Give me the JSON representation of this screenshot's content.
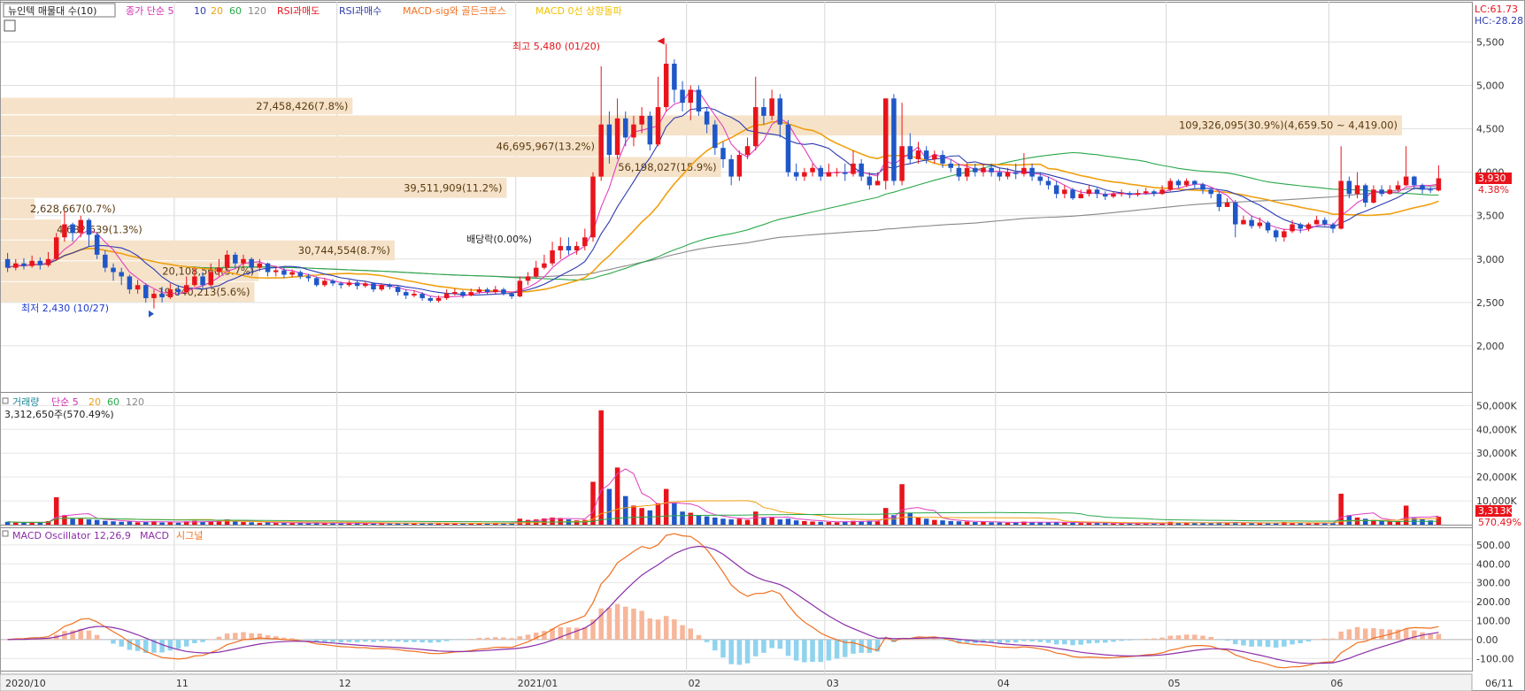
{
  "legend": {
    "stock_name": "뉴인텍 매물대 수(10)",
    "ma_label": "종가 단순 5",
    "ma_10": "10",
    "ma_20": "20",
    "ma_60": "60",
    "ma_120": "120",
    "rsi_sell": "RSI과매도",
    "rsi_buy": "RSI과매수",
    "macd_gc": "MACD-sig와 골든크로스",
    "macd_zero": "MACD 0선 상향돌파"
  },
  "corner": {
    "lc": "LC:61.73",
    "hc": "HC:-28.28"
  },
  "price_tags": {
    "current": "3,930",
    "pct": "4.38%"
  },
  "annotations": {
    "high": "최고 5,480 (01/20)",
    "low": "최저 2,430 (10/27)",
    "dividend": "배당락(0.00%)"
  },
  "volume_legend": {
    "title": "거래량",
    "ma": "단순 5",
    "p20": "20",
    "p60": "60",
    "p120": "120",
    "info": "3,312,650주(570.49%)"
  },
  "volume_tags": {
    "current": "3,313K",
    "pct": "570.49%"
  },
  "macd_legend": {
    "title": "MACD Oscillator 12,26,9",
    "macd": "MACD",
    "signal": "시그널"
  },
  "colors": {
    "up": "#e8141c",
    "down": "#1f57c8",
    "ma5": "#e040c0",
    "ma10": "#2d3bb0",
    "ma20": "#f0a010",
    "ma60": "#2aa84a",
    "ma120": "#888888",
    "vp": "#f5e2c8",
    "macd_pos": "#f7b69a",
    "macd_neg": "#8fd3ee",
    "macd": "#8b2ea8",
    "signal": "#f07020"
  },
  "chart_data": {
    "type": "candlestick",
    "date_ticks": [
      "2020/10",
      "11",
      "12",
      "2021/01",
      "02",
      "03",
      "04",
      "05",
      "06",
      "06/11"
    ],
    "price_axis": {
      "ticks": [
        "5,500",
        "5,000",
        "4,500",
        "4,000",
        "3,500",
        "3,000",
        "2,500",
        "2,000"
      ],
      "range": [
        1500,
        5780
      ]
    },
    "volume_axis": {
      "ticks": [
        "50,000K",
        "40,000K",
        "30,000K",
        "20,000K",
        "10,000K"
      ],
      "range": [
        0,
        52000
      ]
    },
    "macd_axis": {
      "ticks": [
        "500.00",
        "400.00",
        "300.00",
        "200.00",
        "100.00",
        "0.00",
        "-100.00"
      ],
      "range": [
        -150,
        560
      ]
    },
    "volume_profile": [
      {
        "label": "27,458,426(7.8%)",
        "price_lo": 4663,
        "price_hi": 4863,
        "width_frac": 0.251
      },
      {
        "label": "109,326,095(30.9%)(4,659.50 ~ 4,419.00)",
        "price_lo": 4419,
        "price_hi": 4660,
        "width_frac": 1.0
      },
      {
        "label": "46,695,967(13.2%)",
        "price_lo": 4180,
        "price_hi": 4419,
        "width_frac": 0.427
      },
      {
        "label": "56,198,027(15.9%)",
        "price_lo": 3940,
        "price_hi": 4180,
        "width_frac": 0.514
      },
      {
        "label": "39,511,909(11.2%)",
        "price_lo": 3700,
        "price_hi": 3940,
        "width_frac": 0.361
      },
      {
        "label": "2,628,667(0.7%)",
        "price_lo": 3460,
        "price_hi": 3700,
        "width_frac": 0.024
      },
      {
        "label": "4,682,639(1.3%)",
        "price_lo": 3220,
        "price_hi": 3460,
        "width_frac": 0.043
      },
      {
        "label": "30,744,554(8.7%)",
        "price_lo": 2980,
        "price_hi": 3220,
        "width_frac": 0.281
      },
      {
        "label": "20,108,560(5.7%)",
        "price_lo": 2740,
        "price_hi": 2980,
        "width_frac": 0.184
      },
      {
        "label": "19,840,213(5.6%)",
        "price_lo": 2500,
        "price_hi": 2740,
        "width_frac": 0.181
      }
    ],
    "candles": [
      [
        3000,
        2900,
        3070,
        2850,
        1200
      ],
      [
        2900,
        2950,
        3000,
        2870,
        900
      ],
      [
        2950,
        2920,
        3010,
        2880,
        800
      ],
      [
        2920,
        2980,
        3040,
        2900,
        1000
      ],
      [
        2980,
        2930,
        3020,
        2880,
        900
      ],
      [
        2930,
        3000,
        3080,
        2910,
        1500
      ],
      [
        3000,
        3250,
        3300,
        2980,
        11500
      ],
      [
        3250,
        3400,
        3550,
        3200,
        4000
      ],
      [
        3400,
        3300,
        3420,
        3200,
        2500
      ],
      [
        3300,
        3450,
        3500,
        3250,
        2800
      ],
      [
        3450,
        3280,
        3470,
        3150,
        2200
      ],
      [
        3280,
        3050,
        3300,
        3000,
        2000
      ],
      [
        3050,
        2900,
        3100,
        2850,
        1600
      ],
      [
        2900,
        2850,
        2950,
        2750,
        1400
      ],
      [
        2850,
        2800,
        2900,
        2700,
        1200
      ],
      [
        2800,
        2650,
        2820,
        2600,
        1300
      ],
      [
        2650,
        2700,
        2760,
        2600,
        1000
      ],
      [
        2700,
        2550,
        2720,
        2500,
        1200
      ],
      [
        2550,
        2600,
        2650,
        2430,
        1500
      ],
      [
        2600,
        2560,
        2680,
        2500,
        900
      ],
      [
        2560,
        2650,
        2720,
        2540,
        1100
      ],
      [
        2650,
        2620,
        2700,
        2580,
        800
      ],
      [
        2620,
        2700,
        2800,
        2600,
        1400
      ],
      [
        2700,
        2800,
        2900,
        2680,
        1600
      ],
      [
        2800,
        2700,
        2850,
        2650,
        1200
      ],
      [
        2700,
        2850,
        2950,
        2680,
        1500
      ],
      [
        2850,
        2900,
        3000,
        2800,
        1400
      ],
      [
        2900,
        3050,
        3100,
        2880,
        2200
      ],
      [
        3050,
        2950,
        3080,
        2900,
        1500
      ],
      [
        2950,
        3000,
        3050,
        2900,
        1100
      ],
      [
        3000,
        2900,
        3020,
        2850,
        1000
      ],
      [
        2900,
        2950,
        3000,
        2860,
        800
      ],
      [
        2950,
        2850,
        2960,
        2800,
        900
      ],
      [
        2850,
        2870,
        2920,
        2800,
        700
      ],
      [
        2870,
        2820,
        2900,
        2780,
        800
      ],
      [
        2820,
        2850,
        2880,
        2790,
        600
      ],
      [
        2850,
        2800,
        2870,
        2770,
        700
      ],
      [
        2800,
        2780,
        2830,
        2740,
        600
      ],
      [
        2780,
        2700,
        2800,
        2680,
        800
      ],
      [
        2700,
        2750,
        2780,
        2680,
        700
      ],
      [
        2750,
        2720,
        2770,
        2690,
        600
      ],
      [
        2720,
        2700,
        2740,
        2660,
        500
      ],
      [
        2700,
        2730,
        2760,
        2680,
        500
      ],
      [
        2730,
        2690,
        2750,
        2650,
        600
      ],
      [
        2690,
        2720,
        2740,
        2670,
        500
      ],
      [
        2720,
        2650,
        2730,
        2620,
        700
      ],
      [
        2650,
        2700,
        2720,
        2630,
        600
      ],
      [
        2700,
        2680,
        2720,
        2650,
        500
      ],
      [
        2680,
        2620,
        2700,
        2580,
        700
      ],
      [
        2620,
        2580,
        2650,
        2540,
        800
      ],
      [
        2580,
        2600,
        2640,
        2560,
        600
      ],
      [
        2600,
        2550,
        2620,
        2520,
        700
      ],
      [
        2550,
        2520,
        2570,
        2500,
        600
      ],
      [
        2520,
        2550,
        2580,
        2500,
        500
      ],
      [
        2550,
        2600,
        2650,
        2530,
        600
      ],
      [
        2600,
        2620,
        2660,
        2580,
        500
      ],
      [
        2620,
        2580,
        2640,
        2550,
        600
      ],
      [
        2580,
        2620,
        2660,
        2570,
        500
      ],
      [
        2620,
        2650,
        2680,
        2600,
        600
      ],
      [
        2650,
        2620,
        2670,
        2590,
        500
      ],
      [
        2620,
        2650,
        2690,
        2600,
        700
      ],
      [
        2650,
        2600,
        2670,
        2580,
        600
      ],
      [
        2600,
        2570,
        2620,
        2540,
        800
      ],
      [
        2570,
        2750,
        2800,
        2560,
        2500
      ],
      [
        2750,
        2800,
        2850,
        2700,
        2000
      ],
      [
        2800,
        2900,
        2980,
        2780,
        2200
      ],
      [
        2900,
        2950,
        3050,
        2880,
        2600
      ],
      [
        2950,
        3100,
        3200,
        2920,
        3000
      ],
      [
        3100,
        3150,
        3250,
        3000,
        2800
      ],
      [
        3150,
        3100,
        3250,
        3050,
        2200
      ],
      [
        3100,
        3150,
        3200,
        3050,
        1800
      ],
      [
        3150,
        3250,
        3350,
        3100,
        2000
      ],
      [
        3250,
        3950,
        4000,
        3200,
        18000
      ],
      [
        3950,
        4550,
        5220,
        3900,
        48000
      ],
      [
        4550,
        4200,
        4700,
        4100,
        15000
      ],
      [
        4200,
        4620,
        4850,
        4150,
        24000
      ],
      [
        4620,
        4400,
        4700,
        4300,
        12000
      ],
      [
        4400,
        4550,
        4650,
        4300,
        8000
      ],
      [
        4550,
        4650,
        4750,
        4450,
        7000
      ],
      [
        4650,
        4320,
        4700,
        4250,
        6000
      ],
      [
        4320,
        4750,
        5100,
        4300,
        9000
      ],
      [
        4750,
        5250,
        5480,
        4700,
        15000
      ],
      [
        5250,
        4950,
        5300,
        4800,
        9000
      ],
      [
        4950,
        4800,
        5050,
        4700,
        5500
      ],
      [
        4800,
        4950,
        5000,
        4600,
        5000
      ],
      [
        4950,
        4700,
        5000,
        4650,
        4000
      ],
      [
        4700,
        4550,
        4750,
        4450,
        3500
      ],
      [
        4550,
        4280,
        4600,
        4200,
        3000
      ],
      [
        4280,
        4150,
        4350,
        4050,
        2500
      ],
      [
        4150,
        3950,
        4200,
        3850,
        2200
      ],
      [
        3950,
        4200,
        4250,
        3900,
        2500
      ],
      [
        4200,
        4300,
        4400,
        4150,
        2000
      ],
      [
        4300,
        4750,
        5100,
        4250,
        5500
      ],
      [
        4750,
        4650,
        4850,
        4550,
        2800
      ],
      [
        4650,
        4850,
        4950,
        4600,
        3000
      ],
      [
        4850,
        4550,
        4900,
        4400,
        2200
      ],
      [
        4550,
        4000,
        4600,
        3950,
        2500
      ],
      [
        4000,
        3950,
        4100,
        3900,
        1800
      ],
      [
        3950,
        4000,
        4050,
        3900,
        1500
      ],
      [
        4000,
        4050,
        4100,
        3950,
        1300
      ],
      [
        4050,
        3950,
        4080,
        3900,
        1200
      ],
      [
        3950,
        4000,
        4100,
        3950,
        1100
      ],
      [
        4000,
        4000,
        4050,
        3950,
        1000
      ],
      [
        4000,
        3980,
        4100,
        3900,
        1400
      ],
      [
        3980,
        4100,
        4250,
        3950,
        1600
      ],
      [
        4100,
        3950,
        4150,
        3900,
        1500
      ],
      [
        3950,
        3850,
        4000,
        3800,
        1700
      ],
      [
        3850,
        3900,
        4000,
        3850,
        1400
      ],
      [
        3900,
        4850,
        4850,
        3800,
        7000
      ],
      [
        4850,
        3900,
        4900,
        3850,
        4000
      ],
      [
        3900,
        4300,
        4800,
        3850,
        17000
      ],
      [
        4300,
        4150,
        4450,
        4100,
        5000
      ],
      [
        4150,
        4250,
        4350,
        4100,
        3000
      ],
      [
        4250,
        4150,
        4300,
        4100,
        2500
      ],
      [
        4150,
        4200,
        4250,
        4100,
        2000
      ],
      [
        4200,
        4100,
        4250,
        4050,
        1800
      ],
      [
        4100,
        4050,
        4150,
        4000,
        1500
      ],
      [
        4050,
        3950,
        4100,
        3900,
        1400
      ],
      [
        3950,
        4050,
        4100,
        3900,
        1300
      ],
      [
        4050,
        4000,
        4100,
        3950,
        1100
      ],
      [
        4000,
        4050,
        4100,
        3950,
        1200
      ],
      [
        4050,
        4000,
        4100,
        3950,
        1000
      ],
      [
        4000,
        3950,
        4050,
        3900,
        900
      ],
      [
        3950,
        4000,
        4050,
        3920,
        800
      ],
      [
        4000,
        3980,
        4100,
        3920,
        900
      ],
      [
        3980,
        4050,
        4220,
        3950,
        1300
      ],
      [
        4050,
        3950,
        4100,
        3900,
        1100
      ],
      [
        3950,
        3900,
        4000,
        3850,
        1000
      ],
      [
        3900,
        3850,
        3950,
        3800,
        900
      ],
      [
        3850,
        3750,
        3900,
        3700,
        1100
      ],
      [
        3750,
        3800,
        3850,
        3700,
        800
      ],
      [
        3800,
        3700,
        3820,
        3680,
        900
      ],
      [
        3700,
        3750,
        3800,
        3700,
        700
      ],
      [
        3750,
        3800,
        3850,
        3720,
        800
      ],
      [
        3800,
        3750,
        3820,
        3700,
        700
      ],
      [
        3750,
        3720,
        3780,
        3680,
        600
      ],
      [
        3720,
        3750,
        3780,
        3700,
        500
      ],
      [
        3750,
        3760,
        3800,
        3720,
        500
      ],
      [
        3760,
        3740,
        3780,
        3700,
        500
      ],
      [
        3740,
        3760,
        3800,
        3720,
        500
      ],
      [
        3760,
        3780,
        3820,
        3740,
        600
      ],
      [
        3780,
        3750,
        3800,
        3720,
        500
      ],
      [
        3750,
        3800,
        3850,
        3740,
        700
      ],
      [
        3800,
        3900,
        3930,
        3780,
        1200
      ],
      [
        3900,
        3850,
        3920,
        3820,
        900
      ],
      [
        3850,
        3900,
        3930,
        3830,
        800
      ],
      [
        3900,
        3860,
        3910,
        3820,
        700
      ],
      [
        3860,
        3800,
        3880,
        3750,
        700
      ],
      [
        3800,
        3750,
        3820,
        3700,
        800
      ],
      [
        3750,
        3600,
        3780,
        3550,
        1000
      ],
      [
        3600,
        3650,
        3700,
        3600,
        800
      ],
      [
        3650,
        3400,
        3680,
        3250,
        1100
      ],
      [
        3400,
        3450,
        3500,
        3400,
        700
      ],
      [
        3450,
        3380,
        3500,
        3350,
        700
      ],
      [
        3380,
        3420,
        3480,
        3350,
        600
      ],
      [
        3420,
        3330,
        3440,
        3300,
        600
      ],
      [
        3330,
        3250,
        3350,
        3200,
        800
      ],
      [
        3250,
        3320,
        3350,
        3200,
        1100
      ],
      [
        3320,
        3400,
        3450,
        3300,
        700
      ],
      [
        3400,
        3350,
        3420,
        3300,
        600
      ],
      [
        3350,
        3400,
        3420,
        3320,
        500
      ],
      [
        3400,
        3450,
        3500,
        3400,
        700
      ],
      [
        3450,
        3400,
        3480,
        3380,
        600
      ],
      [
        3400,
        3350,
        3420,
        3300,
        700
      ],
      [
        3350,
        3900,
        4300,
        3340,
        13000
      ],
      [
        3900,
        3750,
        3950,
        3700,
        4000
      ],
      [
        3750,
        3850,
        4000,
        3700,
        3000
      ],
      [
        3850,
        3650,
        3870,
        3600,
        2500
      ],
      [
        3650,
        3800,
        3850,
        3640,
        2000
      ],
      [
        3800,
        3750,
        3850,
        3720,
        1600
      ],
      [
        3750,
        3800,
        3850,
        3740,
        1500
      ],
      [
        3800,
        3850,
        3900,
        3780,
        1500
      ],
      [
        3850,
        3950,
        4300,
        3840,
        8000
      ],
      [
        3950,
        3850,
        3960,
        3800,
        2800
      ],
      [
        3850,
        3800,
        3870,
        3750,
        2200
      ],
      [
        3800,
        3790,
        3830,
        3760,
        1800
      ],
      [
        3790,
        3930,
        4080,
        3780,
        3313
      ]
    ],
    "ma_periods": [
      5,
      10,
      20,
      60,
      120
    ],
    "macd_params": [
      12,
      26,
      9
    ]
  }
}
